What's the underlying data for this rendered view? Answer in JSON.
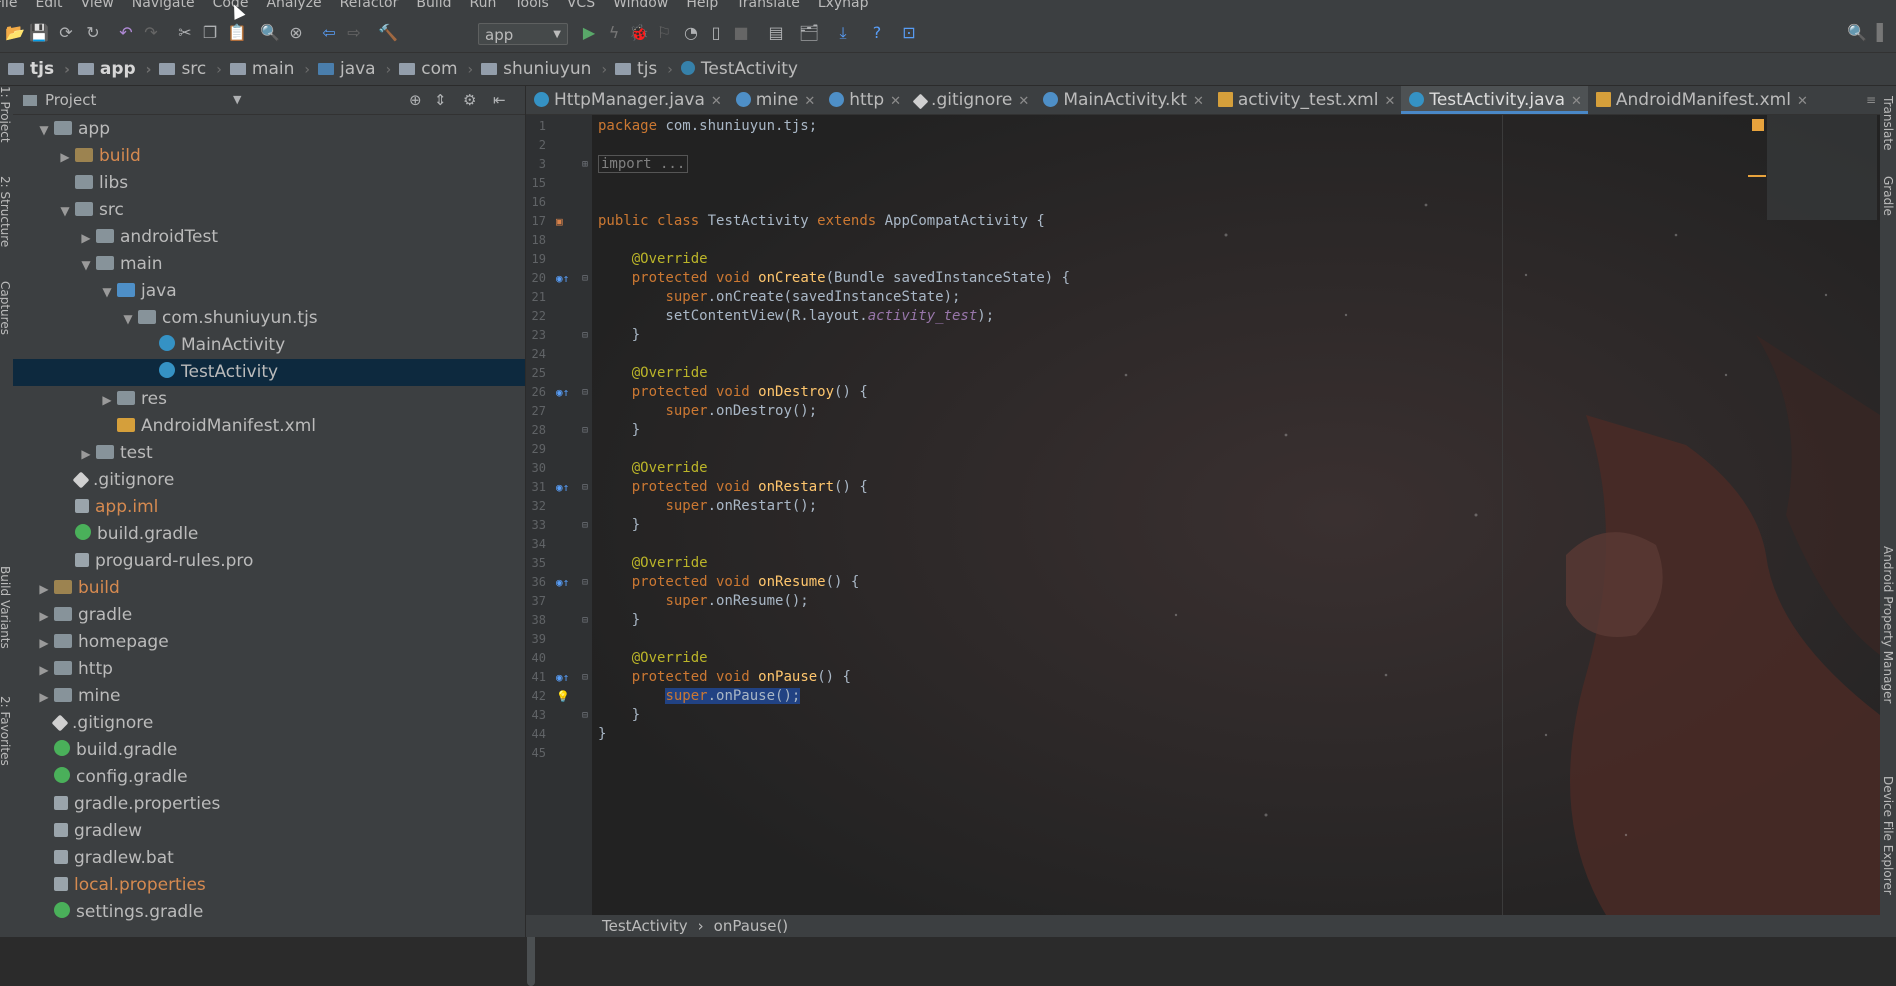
{
  "menu": [
    "File",
    "Edit",
    "View",
    "Navigate",
    "Code",
    "Analyze",
    "Refactor",
    "Build",
    "Run",
    "Tools",
    "VCS",
    "Window",
    "Help",
    "Translate",
    "Lxynap"
  ],
  "toolbar": {
    "run_config": "app"
  },
  "breadcrumbs": [
    "tjs",
    "app",
    "src",
    "main",
    "java",
    "com",
    "shuniuyun",
    "tjs",
    "TestActivity"
  ],
  "left_strip": [
    "1: Project",
    "2: Structure",
    "Captures",
    "Build Variants",
    "2: Favorites"
  ],
  "project_panel": {
    "title": "Project",
    "tree": [
      {
        "label": "app",
        "indent": 1,
        "toggle": "▼",
        "icon": "folder",
        "color": ""
      },
      {
        "label": "build",
        "indent": 2,
        "toggle": "▶",
        "icon": "folder orange",
        "color": "orange"
      },
      {
        "label": "libs",
        "indent": 2,
        "toggle": "",
        "icon": "folder",
        "color": ""
      },
      {
        "label": "src",
        "indent": 2,
        "toggle": "▼",
        "icon": "folder",
        "color": ""
      },
      {
        "label": "androidTest",
        "indent": 3,
        "toggle": "▶",
        "icon": "folder",
        "color": ""
      },
      {
        "label": "main",
        "indent": 3,
        "toggle": "▼",
        "icon": "folder",
        "color": ""
      },
      {
        "label": "java",
        "indent": 4,
        "toggle": "▼",
        "icon": "folder blue",
        "color": ""
      },
      {
        "label": "com.shuniuyun.tjs",
        "indent": 5,
        "toggle": "▼",
        "icon": "folder",
        "color": ""
      },
      {
        "label": "MainActivity",
        "indent": 6,
        "toggle": "",
        "icon": "cls",
        "color": ""
      },
      {
        "label": "TestActivity",
        "indent": 6,
        "toggle": "",
        "icon": "cls",
        "color": "",
        "selected": true
      },
      {
        "label": "res",
        "indent": 4,
        "toggle": "▶",
        "icon": "folder",
        "color": ""
      },
      {
        "label": "AndroidManifest.xml",
        "indent": 4,
        "toggle": "",
        "icon": "xml",
        "color": ""
      },
      {
        "label": "test",
        "indent": 3,
        "toggle": "▶",
        "icon": "folder",
        "color": ""
      },
      {
        "label": ".gitignore",
        "indent": 2,
        "toggle": "",
        "icon": "git",
        "color": ""
      },
      {
        "label": "app.iml",
        "indent": 2,
        "toggle": "",
        "icon": "file",
        "color": "orange"
      },
      {
        "label": "build.gradle",
        "indent": 2,
        "toggle": "",
        "icon": "gradle",
        "color": ""
      },
      {
        "label": "proguard-rules.pro",
        "indent": 2,
        "toggle": "",
        "icon": "file",
        "color": ""
      },
      {
        "label": "build",
        "indent": 1,
        "toggle": "▶",
        "icon": "folder orange",
        "color": "orange"
      },
      {
        "label": "gradle",
        "indent": 1,
        "toggle": "▶",
        "icon": "folder",
        "color": ""
      },
      {
        "label": "homepage",
        "indent": 1,
        "toggle": "▶",
        "icon": "mod",
        "color": ""
      },
      {
        "label": "http",
        "indent": 1,
        "toggle": "▶",
        "icon": "mod",
        "color": ""
      },
      {
        "label": "mine",
        "indent": 1,
        "toggle": "▶",
        "icon": "mod",
        "color": ""
      },
      {
        "label": ".gitignore",
        "indent": 1,
        "toggle": "",
        "icon": "git",
        "color": ""
      },
      {
        "label": "build.gradle",
        "indent": 1,
        "toggle": "",
        "icon": "gradle",
        "color": ""
      },
      {
        "label": "config.gradle",
        "indent": 1,
        "toggle": "",
        "icon": "gradle",
        "color": ""
      },
      {
        "label": "gradle.properties",
        "indent": 1,
        "toggle": "",
        "icon": "file",
        "color": ""
      },
      {
        "label": "gradlew",
        "indent": 1,
        "toggle": "",
        "icon": "file",
        "color": ""
      },
      {
        "label": "gradlew.bat",
        "indent": 1,
        "toggle": "",
        "icon": "file",
        "color": ""
      },
      {
        "label": "local.properties",
        "indent": 1,
        "toggle": "",
        "icon": "file",
        "color": "orange"
      },
      {
        "label": "settings.gradle",
        "indent": 1,
        "toggle": "",
        "icon": "gradle",
        "color": ""
      }
    ]
  },
  "tabs": [
    {
      "label": "HttpManager.java",
      "icon": "cls",
      "active": false
    },
    {
      "label": "mine",
      "icon": "kt",
      "active": false
    },
    {
      "label": "http",
      "icon": "kt",
      "active": false
    },
    {
      "label": ".gitignore",
      "icon": "git",
      "active": false
    },
    {
      "label": "MainActivity.kt",
      "icon": "kt",
      "active": false
    },
    {
      "label": "activity_test.xml",
      "icon": "xml",
      "active": false
    },
    {
      "label": "TestActivity.java",
      "icon": "cls",
      "active": true
    },
    {
      "label": "AndroidManifest.xml",
      "icon": "xml",
      "active": false
    }
  ],
  "code": [
    {
      "n": "1",
      "html": "<span class=\"kw\">package</span> com.shuniuyun.tjs;"
    },
    {
      "n": "2",
      "html": ""
    },
    {
      "n": "3",
      "html": "<span class=\"fd\">import ...</span>",
      "fold": "+"
    },
    {
      "n": "15",
      "html": ""
    },
    {
      "n": "16",
      "html": ""
    },
    {
      "n": "17",
      "html": "<span class=\"kw\">public class</span> TestActivity <span class=\"kw\">extends</span> AppCompatActivity {",
      "mark": "▣"
    },
    {
      "n": "18",
      "html": ""
    },
    {
      "n": "19",
      "html": "    <span class=\"an\">@Override</span>"
    },
    {
      "n": "20",
      "html": "    <span class=\"kw\">protected void</span> <span class=\"fn\">onCreate</span>(Bundle savedInstanceState) {",
      "mark": "◉↑",
      "fold": "-"
    },
    {
      "n": "21",
      "html": "        <span class=\"kw\">super</span>.onCreate(savedInstanceState);"
    },
    {
      "n": "22",
      "html": "        setContentView(R.layout.<span class=\"it\">activity_test</span>);"
    },
    {
      "n": "23",
      "html": "    }",
      "fold": "-"
    },
    {
      "n": "24",
      "html": ""
    },
    {
      "n": "25",
      "html": "    <span class=\"an\">@Override</span>"
    },
    {
      "n": "26",
      "html": "    <span class=\"kw\">protected void</span> <span class=\"fn\">onDestroy</span>() {",
      "mark": "◉↑",
      "fold": "-"
    },
    {
      "n": "27",
      "html": "        <span class=\"kw\">super</span>.onDestroy();"
    },
    {
      "n": "28",
      "html": "    }",
      "fold": "-"
    },
    {
      "n": "29",
      "html": ""
    },
    {
      "n": "30",
      "html": "    <span class=\"an\">@Override</span>"
    },
    {
      "n": "31",
      "html": "    <span class=\"kw\">protected void</span> <span class=\"fn\">onRestart</span>() {",
      "mark": "◉↑",
      "fold": "-"
    },
    {
      "n": "32",
      "html": "        <span class=\"kw\">super</span>.onRestart();"
    },
    {
      "n": "33",
      "html": "    }",
      "fold": "-"
    },
    {
      "n": "34",
      "html": ""
    },
    {
      "n": "35",
      "html": "    <span class=\"an\">@Override</span>"
    },
    {
      "n": "36",
      "html": "    <span class=\"kw\">protected void</span> <span class=\"fn\">onResume</span>() {",
      "mark": "◉↑",
      "fold": "-"
    },
    {
      "n": "37",
      "html": "        <span class=\"kw\">super</span>.onResume();"
    },
    {
      "n": "38",
      "html": "    }",
      "fold": "-"
    },
    {
      "n": "39",
      "html": ""
    },
    {
      "n": "40",
      "html": "    <span class=\"an\">@Override</span>"
    },
    {
      "n": "41",
      "html": "    <span class=\"kw\">protected void</span> <span class=\"fn\">onPause</span>() {",
      "mark": "◉↑",
      "fold": "-"
    },
    {
      "n": "42",
      "html": "        <span class=\"hl\"><span class=\"kw\">super</span>.onPause();</span>",
      "mark": "💡"
    },
    {
      "n": "43",
      "html": "    }",
      "fold": "-"
    },
    {
      "n": "44",
      "html": "}"
    },
    {
      "n": "45",
      "html": ""
    }
  ],
  "right_strip": [
    "Translate",
    "Gradle",
    "Android Property Manager",
    "Device File Explorer"
  ],
  "status": {
    "class": "TestActivity",
    "method": "onPause()"
  }
}
